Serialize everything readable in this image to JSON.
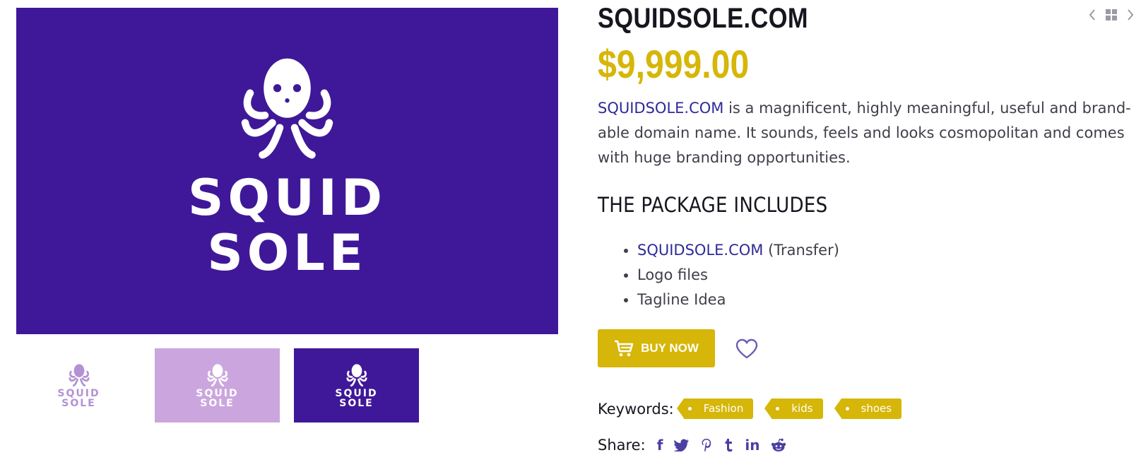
{
  "product": {
    "title": "SQUIDSOLE.COM",
    "price": "$9,999.00",
    "description_link": "SQUIDSOLE.COM",
    "description_rest": " is a magnificent, highly meaningful, useful and brand-able domain name. It sounds, feels and looks cosmopolitan and comes with huge branding opportunities."
  },
  "gallery": {
    "logo_line1": "SQUID",
    "logo_line2": "SOLE",
    "thumbnails": [
      {
        "line1": "SQUID",
        "line2": "SOLE",
        "bg": "#ffffff"
      },
      {
        "line1": "SQUID",
        "line2": "SOLE",
        "bg": "#cba6de"
      },
      {
        "line1": "SQUID",
        "line2": "SOLE",
        "bg": "#3f1899"
      }
    ]
  },
  "package": {
    "heading": "THE PACKAGE INCLUDES",
    "items": [
      {
        "link": "SQUIDSOLE.COM",
        "text": " (Transfer)"
      },
      {
        "text": "Logo files"
      },
      {
        "text": "Tagline Idea"
      }
    ]
  },
  "actions": {
    "buy_label": "BUY NOW"
  },
  "keywords": {
    "label": "Keywords:",
    "tags": [
      "Fashion",
      "kids",
      "shoes"
    ]
  },
  "share": {
    "label": "Share:",
    "icons": [
      "facebook-icon",
      "twitter-icon",
      "pinterest-icon",
      "tumblr-icon",
      "linkedin-icon",
      "reddit-icon"
    ]
  },
  "nav": {
    "icons": [
      "chevron-left-icon",
      "grid-icon",
      "chevron-right-icon"
    ]
  },
  "colors": {
    "brand_purple": "#3f1899",
    "accent_yellow": "#d6b608",
    "link_blue": "#2f2a97",
    "lavender": "#cba6de"
  }
}
